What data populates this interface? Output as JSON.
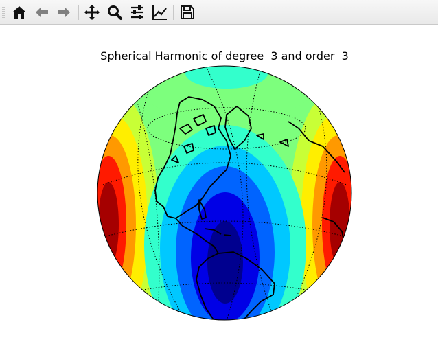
{
  "toolbar": {
    "buttons": [
      {
        "name": "home-button",
        "icon": "home-icon"
      },
      {
        "name": "back-button",
        "icon": "arrow-left-icon"
      },
      {
        "name": "forward-button",
        "icon": "arrow-right-icon"
      },
      {
        "name": "pan-button",
        "icon": "move-icon"
      },
      {
        "name": "zoom-button",
        "icon": "magnifier-icon"
      },
      {
        "name": "configure-subplots-button",
        "icon": "sliders-icon"
      },
      {
        "name": "edit-axis-button",
        "icon": "line-chart-icon"
      },
      {
        "name": "save-button",
        "icon": "floppy-disk-icon"
      }
    ]
  },
  "plot": {
    "title": "Spherical Harmonic of degree  3 and order  3",
    "projection": "orthographic",
    "colormap": "jet",
    "colors": {
      "dark_red": "#a50000",
      "red": "#ff1a00",
      "orange": "#ff9900",
      "yellow": "#ffee00",
      "yellow_green": "#c8ff36",
      "green": "#7dff7d",
      "cyan": "#33ffcc",
      "light_blue": "#00c8ff",
      "blue": "#0064ff",
      "deep_blue": "#0000e6",
      "navy": "#00008f",
      "outline": "#000000"
    }
  }
}
